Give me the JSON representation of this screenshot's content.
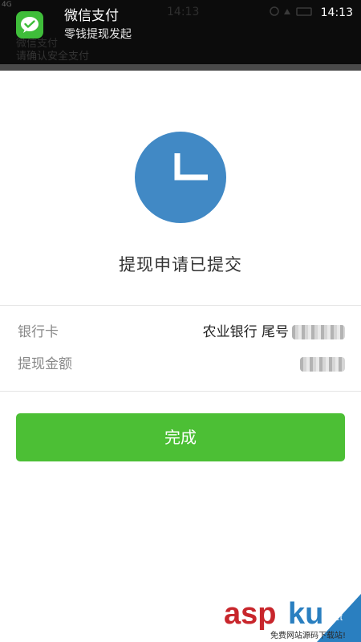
{
  "notification": {
    "app_name": "微信支付",
    "message": "零钱提现发起",
    "time": "14:13",
    "app_icon": "wechat-icon",
    "background_text": {
      "network": "4G",
      "time": "14:13",
      "title": "微信支付",
      "subtitle": "请确认安全支付"
    }
  },
  "status": {
    "icon": "clock-icon",
    "icon_color": "#4189c5",
    "title": "提现申请已提交"
  },
  "details": {
    "bank_card_label": "银行卡",
    "bank_card_value": "农业银行 尾号",
    "withdraw_amount_label": "提现金额"
  },
  "actions": {
    "done_label": "完成",
    "done_color": "#4cbf35"
  },
  "watermark": {
    "brand": "asp",
    "brand_accent": "ku",
    "domain_suffix": ".net",
    "tagline": "免费网站源码下载站!"
  }
}
